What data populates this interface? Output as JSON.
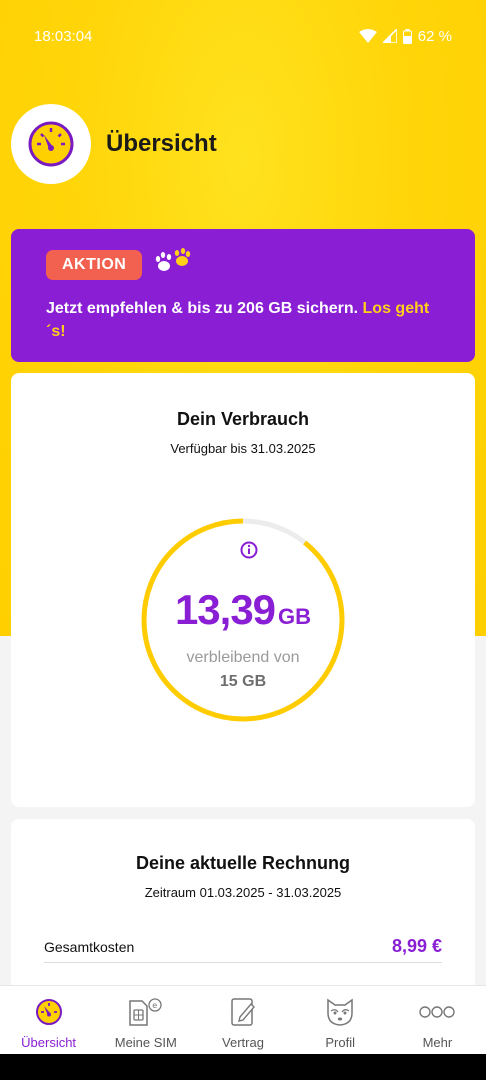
{
  "status": {
    "time": "18:03:04",
    "battery": "62 %"
  },
  "header": {
    "title": "Übersicht"
  },
  "promo": {
    "badge": "AKTION",
    "text": "Jetzt empfehlen & bis zu 206 GB sichern. ",
    "link": "Los geht ´s!"
  },
  "usage": {
    "title": "Dein Verbrauch",
    "available": "Verfügbar bis 31.03.2025",
    "remaining_value": "13,39",
    "remaining_unit": "GB",
    "remaining_label": "verbleibend von",
    "total": "15 GB",
    "remaining_fraction": 0.893
  },
  "bill": {
    "title": "Deine aktuelle Rechnung",
    "period": "Zeitraum 01.03.2025 - 31.03.2025",
    "total_label": "Gesamtkosten",
    "total_amount": "8,99 €"
  },
  "nav": {
    "items": [
      {
        "label": "Übersicht",
        "icon": "dashboard-icon"
      },
      {
        "label": "Meine SIM",
        "icon": "sim-icon"
      },
      {
        "label": "Vertrag",
        "icon": "contract-icon"
      },
      {
        "label": "Profil",
        "icon": "profile-icon"
      },
      {
        "label": "Mehr",
        "icon": "more-icon"
      }
    ]
  },
  "colors": {
    "brand_yellow": "#ffd200",
    "brand_purple": "#8a1ed4",
    "badge_red": "#f2604f"
  }
}
